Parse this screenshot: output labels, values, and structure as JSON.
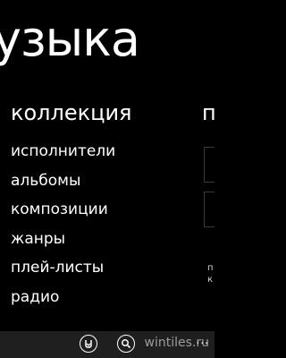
{
  "hub": {
    "title": "узыка"
  },
  "sections": {
    "current_header": "коллекция",
    "next_header_peek": "п"
  },
  "collection_items": [
    "исполнители",
    "альбомы",
    "композиции",
    "жанры",
    "плей-листы",
    "радио"
  ],
  "peek_panel": {
    "text_line_1": "п",
    "text_line_2": "к"
  },
  "app_bar": {
    "buttons": [
      {
        "icon": "smartdj-icon"
      },
      {
        "icon": "search-icon"
      }
    ],
    "ellipsis": "..."
  },
  "watermark": "wintiles.ru"
}
